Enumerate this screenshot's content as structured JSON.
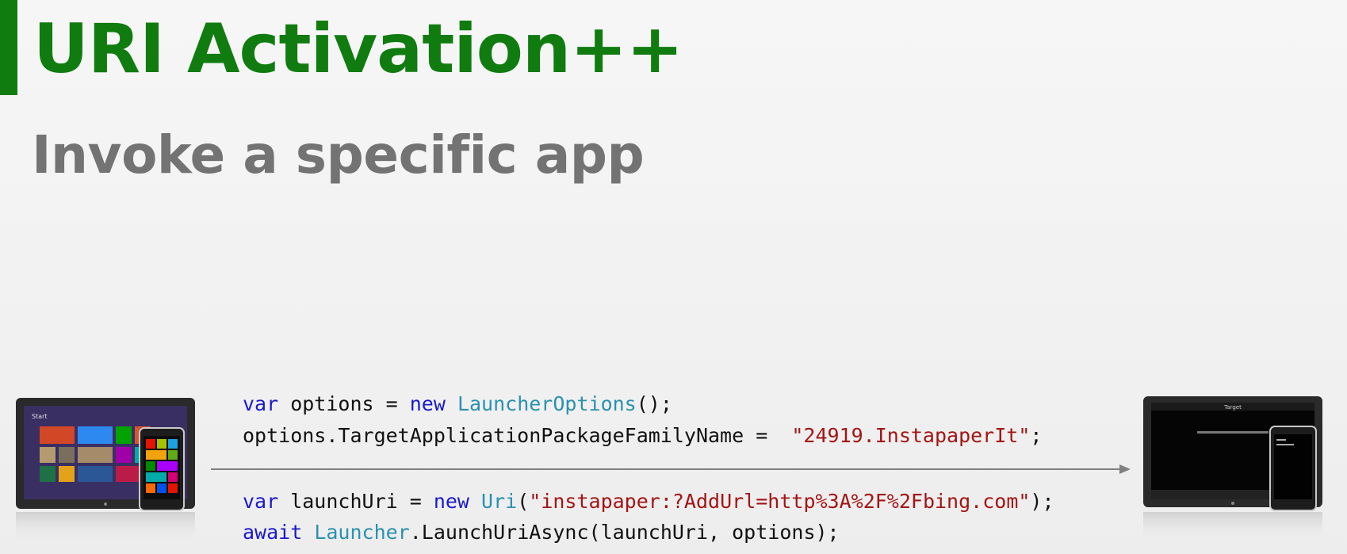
{
  "slide": {
    "title": "URI Activation++",
    "subtitle": "Invoke a specific app",
    "accent_color": "#107c10"
  },
  "code": {
    "line1": {
      "kw_var": "var",
      "ident": " options = ",
      "kw_new": "new",
      "space": " ",
      "type": "LauncherOptions",
      "tail": "();"
    },
    "line2": {
      "ident": "options.TargetApplicationPackageFamilyName =  ",
      "str": "\"24919.InstapaperIt\"",
      "tail": ";"
    },
    "line3": {
      "kw_var": "var",
      "ident": " launchUri = ",
      "kw_new": "new",
      "space": " ",
      "type": "Uri",
      "open": "(",
      "str": "\"instapaper:?AddUrl=http%3A%2F%2Fbing.com\"",
      "tail": ");"
    },
    "line4": {
      "kw_await": "await",
      "space": " ",
      "type": "Launcher",
      "tail": ".LaunchUriAsync(launchUri, options);"
    }
  },
  "devices": {
    "left_icon": "surface-tablet-and-windows-phone-start-screen-icon",
    "right_icon": "surface-tablet-and-windows-phone-target-app-icon",
    "right_screen_title": "Target"
  }
}
